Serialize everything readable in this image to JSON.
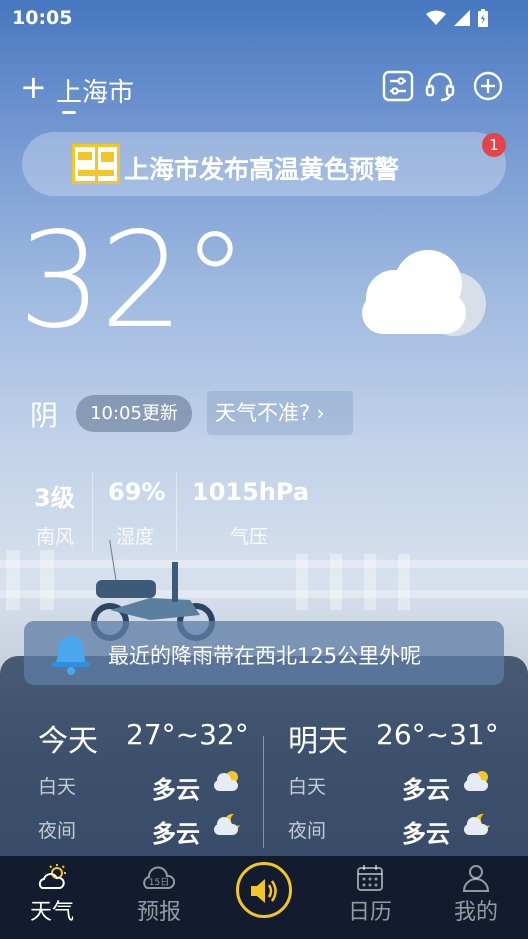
{
  "status_bar": {
    "time": "10:05"
  },
  "header": {
    "city": "上海市"
  },
  "alert": {
    "text": "上海市发布高温黄色预警",
    "badge": "1"
  },
  "current": {
    "temperature": "32°",
    "condition": "阴",
    "update_time": "10:05更新",
    "not_accurate": "天气不准?"
  },
  "stats": [
    {
      "value": "3级",
      "label": "南风"
    },
    {
      "value": "69%",
      "label": "湿度"
    },
    {
      "value": "1015hPa",
      "label": "气压"
    }
  ],
  "rain_notice": "最近的降雨带在西北125公里外呢",
  "forecast": [
    {
      "day": "今天",
      "range": "27°~32°",
      "day_label": "白天",
      "day_cond": "多云",
      "night_label": "夜间",
      "night_cond": "多云"
    },
    {
      "day": "明天",
      "range": "26°~31°",
      "day_label": "白天",
      "day_cond": "多云",
      "night_label": "夜间",
      "night_cond": "多云"
    }
  ],
  "nav": [
    {
      "label": "天气",
      "active": true
    },
    {
      "label": "预报",
      "active": false
    },
    {
      "label": "",
      "active": false
    },
    {
      "label": "日历",
      "active": false
    },
    {
      "label": "我的",
      "active": false
    }
  ],
  "colors": {
    "accent": "#f3c623",
    "alert_badge": "#e2444a",
    "nav_bg": "#131c2e"
  }
}
